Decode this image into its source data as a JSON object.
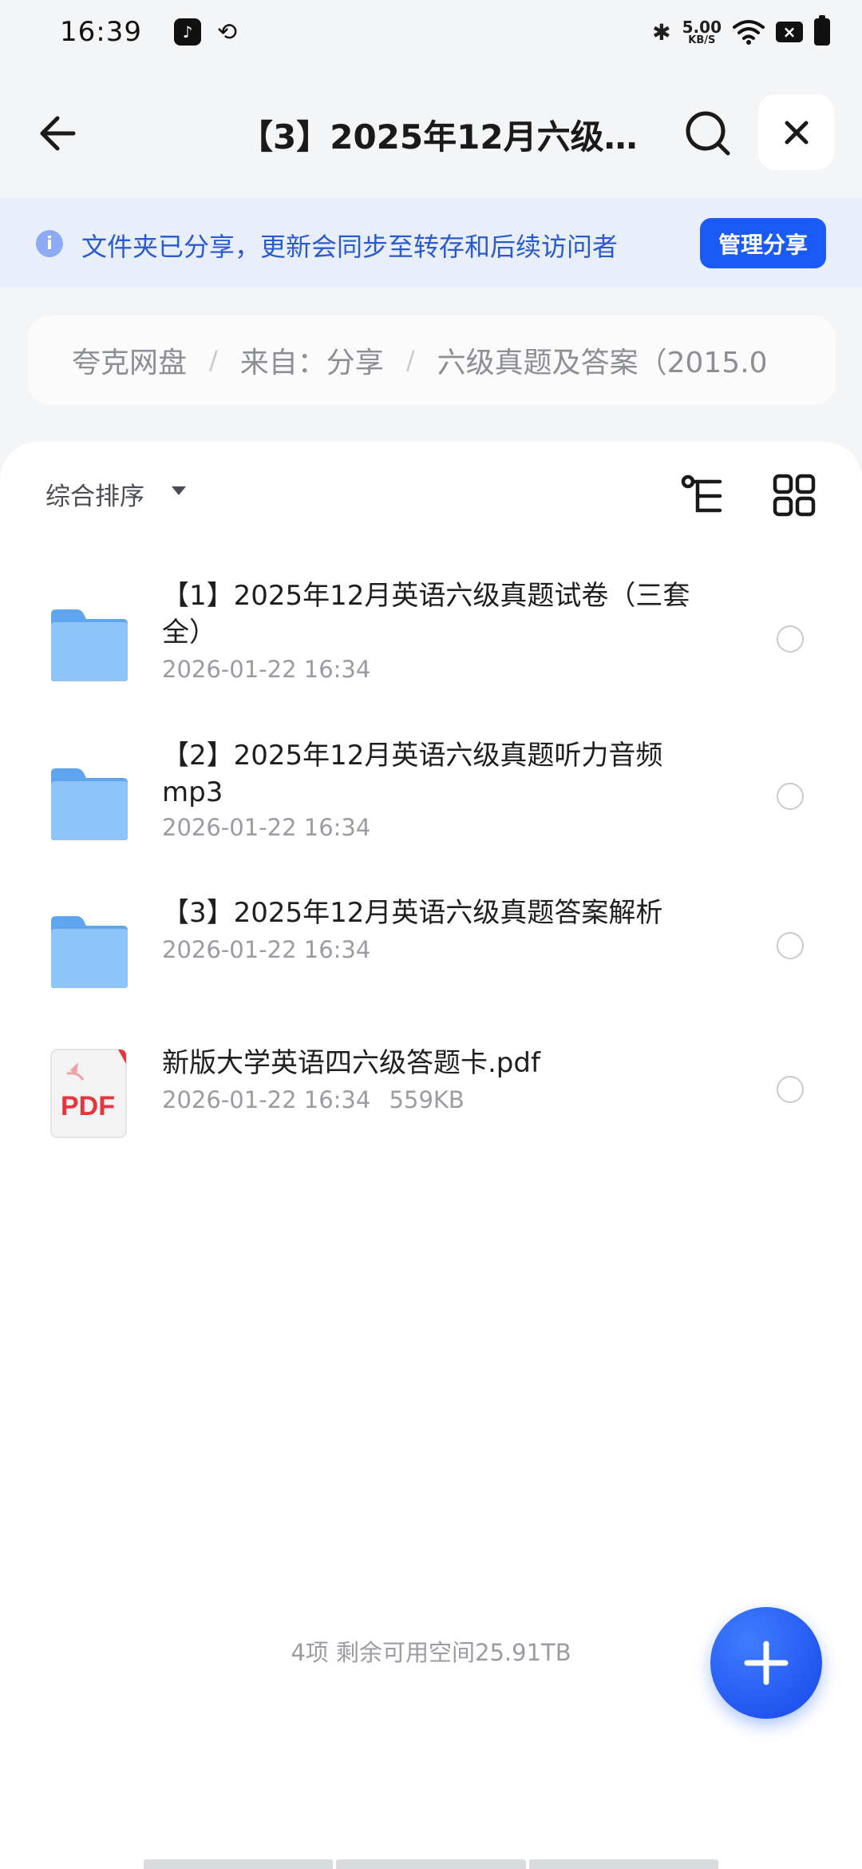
{
  "status_bar": {
    "time": "16:39",
    "net_speed_value": "5.00",
    "net_speed_unit": "KB/S",
    "icons": [
      "tiktok-icon",
      "sync-icon",
      "bluetooth-icon",
      "wifi-icon",
      "sim-off-icon",
      "battery-icon"
    ]
  },
  "header": {
    "title": "【3】2025年12月六级…"
  },
  "share_banner": {
    "text": "文件夹已分享，更新会同步至转存和后续访问者",
    "button": "管理分享"
  },
  "breadcrumb": [
    "夸克网盘",
    "来自：分享",
    "六级真题及答案（2015.0"
  ],
  "toolbar": {
    "sort_label": "综合排序"
  },
  "files": [
    {
      "type": "folder",
      "name": "【1】2025年12月英语六级真题试卷（三套全）",
      "date": "2026-01-22 16:34",
      "size": ""
    },
    {
      "type": "folder",
      "name": "【2】2025年12月英语六级真题听力音频mp3",
      "date": "2026-01-22 16:34",
      "size": ""
    },
    {
      "type": "folder",
      "name": "【3】2025年12月英语六级真题答案解析",
      "date": "2026-01-22 16:34",
      "size": ""
    },
    {
      "type": "pdf",
      "name": "新版大学英语四六级答题卡.pdf",
      "date": "2026-01-22 16:34",
      "size": "559KB",
      "icon_label": "PDF"
    }
  ],
  "summary": "4项 剩余可用空间25.91TB",
  "colors": {
    "accent": "#1a5af7",
    "banner_bg": "#e9eefb",
    "folder": "#6aaef2",
    "pdf_red": "#e5353d"
  }
}
